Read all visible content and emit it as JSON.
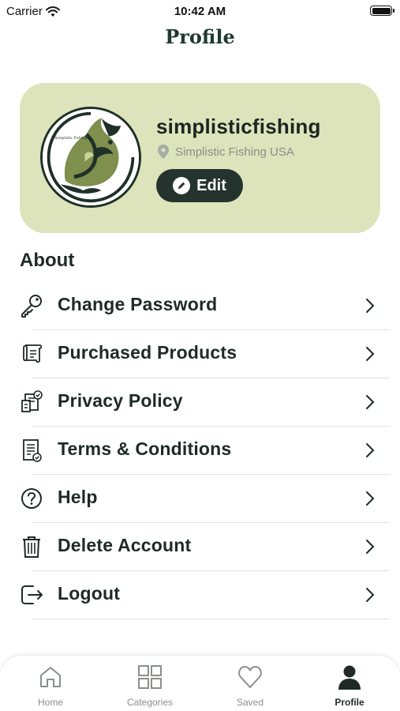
{
  "status_bar": {
    "carrier": "Carrier",
    "time": "10:42 AM"
  },
  "header": {
    "title": "Profile"
  },
  "profile": {
    "username": "simplisticfishing",
    "location": "Simplistic Fishing USA",
    "edit_label": "Edit",
    "logo_text": "Simplistic Fishing"
  },
  "about": {
    "title": "About",
    "items": [
      {
        "label": "Change Password",
        "icon": "key-icon"
      },
      {
        "label": "Purchased Products",
        "icon": "scroll-icon"
      },
      {
        "label": "Privacy Policy",
        "icon": "privacy-document-icon"
      },
      {
        "label": "Terms & Conditions",
        "icon": "terms-document-icon"
      },
      {
        "label": "Help",
        "icon": "help-icon"
      },
      {
        "label": "Delete Account",
        "icon": "trash-icon"
      },
      {
        "label": "Logout",
        "icon": "logout-icon"
      }
    ]
  },
  "tab_bar": {
    "active": "Profile",
    "tabs": [
      {
        "label": "Home",
        "icon": "home-icon"
      },
      {
        "label": "Categories",
        "icon": "grid-icon"
      },
      {
        "label": "Saved",
        "icon": "heart-icon"
      },
      {
        "label": "Profile",
        "icon": "person-icon"
      }
    ]
  },
  "colors": {
    "card_background": "#dde3bb",
    "primary_dark": "#24332d",
    "text": "#1f2a26",
    "muted": "#8a8f86"
  }
}
